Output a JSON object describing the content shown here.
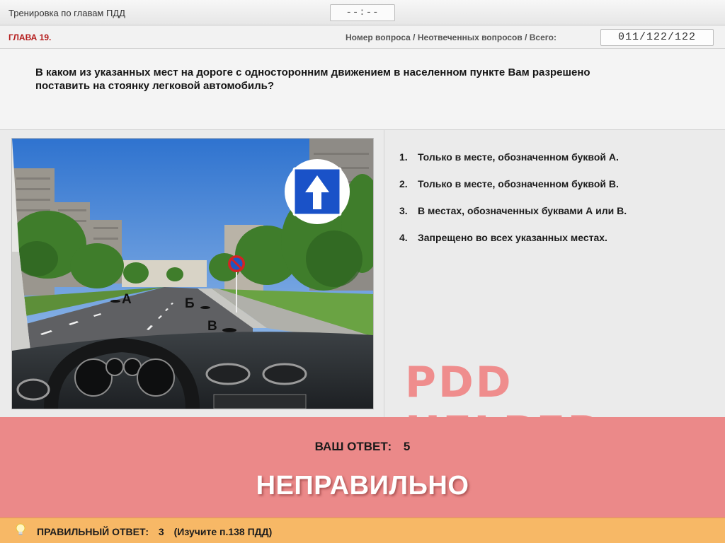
{
  "topbar": {
    "mode_title": "Тренировка по главам ПДД",
    "timer": "--:--"
  },
  "chapterbar": {
    "chapter": "ГЛАВА 19.",
    "counter_label": "Номер вопроса / Неотвеченных вопросов / Всего:",
    "counter": "011/122/122"
  },
  "question": {
    "text": "В каком из указанных мест на дороге с односторонним движением в населенном пункте Вам разрешено поставить на стоянку легковой автомобиль?"
  },
  "scene": {
    "marks": [
      "А",
      "Б",
      "В"
    ],
    "sign_icon": "one-way-road-sign-icon",
    "no-parking_icon": "no-parking-sign-icon"
  },
  "answers": [
    {
      "num": "1.",
      "text": "Только в месте, обозначенном буквой А."
    },
    {
      "num": "2.",
      "text": "Только в месте, обозначенном буквой В."
    },
    {
      "num": "3.",
      "text": "В местах, обозначенных буквами А или В."
    },
    {
      "num": "4.",
      "text": "Запрещено во всех указанных местах."
    }
  ],
  "watermark": "PDD HELPER",
  "result": {
    "your_answer_label": "ВАШ  ОТВЕТ:",
    "your_answer_value": "5",
    "verdict": "НЕПРАВИЛЬНО"
  },
  "hint": {
    "icon": "lightbulb-icon",
    "label": "ПРАВИЛЬНЫЙ ОТВЕТ:",
    "value": "3",
    "reference": "(Изучите п.138 ПДД)"
  },
  "colors": {
    "chapter_red": "#b51d1d",
    "result_bg": "#eb8989",
    "hint_bg": "#f7b866",
    "watermark": "#ef8d8d"
  }
}
